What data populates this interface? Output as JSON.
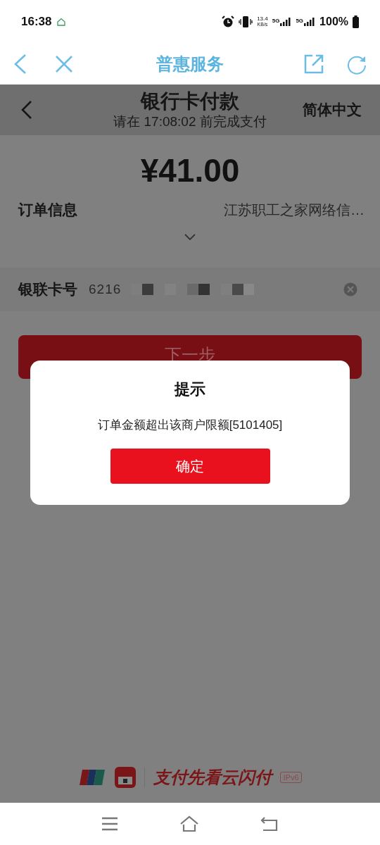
{
  "status_bar": {
    "time": "16:38",
    "net_speed": "13.4",
    "net_unit": "KB/s",
    "sim1": "5G",
    "sim2": "5G",
    "battery": "100%"
  },
  "browser_bar": {
    "title": "普惠服务"
  },
  "header": {
    "title": "银行卡付款",
    "subtitle": "请在 17:08:02 前完成支付",
    "language": "简体中文"
  },
  "amount": "¥41.00",
  "order": {
    "label": "订单信息",
    "value": "江苏职工之家网络信…",
    "expanded": false
  },
  "card": {
    "label": "银联卡号",
    "value": "6216"
  },
  "next_button": "下一步",
  "dialog": {
    "title": "提示",
    "message": "订单金额超出该商户限额[5101405]",
    "button": "确定"
  },
  "footer": {
    "slogan": "支付先看云闪付",
    "badge": "IPv6"
  }
}
